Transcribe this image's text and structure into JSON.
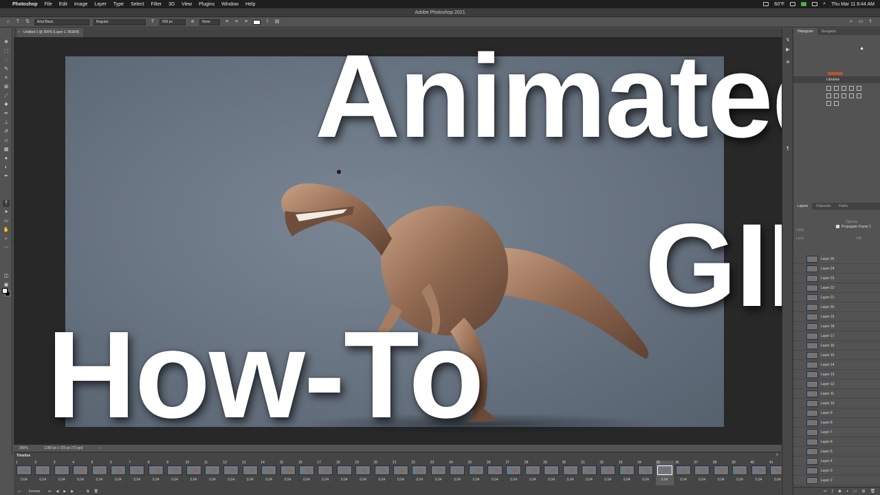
{
  "menubar": {
    "apple": "",
    "app_name": "Photoshop",
    "items": [
      "File",
      "Edit",
      "Image",
      "Layer",
      "Type",
      "Select",
      "Filter",
      "3D",
      "View",
      "Plugins",
      "Window",
      "Help"
    ],
    "weather": "60°F",
    "clock": "Thu Mar 11  8:44 AM"
  },
  "title_bar": {
    "title": "Adobe Photoshop 2021"
  },
  "options_bar": {
    "font_family": "Arial Black",
    "font_style": "Regular",
    "font_size": "559 px",
    "anti_alias": "None",
    "text_color": "#ffffff"
  },
  "document": {
    "tab_title": "Untitled-1 @ 300% (Layer 1, RGB/8)"
  },
  "overlay_text": {
    "line1": "Animated",
    "line2": "GIF",
    "line3": "How-To"
  },
  "status_bar": {
    "zoom": "300%",
    "doc_info": "1280 px x 720 px (72 ppi)",
    "arrow": "›"
  },
  "timeline": {
    "title": "Timeline",
    "loop": "Forever",
    "selected_frame": 35,
    "frames": [
      {
        "n": "1",
        "d": "0.04"
      },
      {
        "n": "2",
        "d": "0.04"
      },
      {
        "n": "3",
        "d": "0.04"
      },
      {
        "n": "4",
        "d": "0.04"
      },
      {
        "n": "5",
        "d": "0.04"
      },
      {
        "n": "6",
        "d": "0.04"
      },
      {
        "n": "7",
        "d": "0.04"
      },
      {
        "n": "8",
        "d": "0.04"
      },
      {
        "n": "9",
        "d": "0.04"
      },
      {
        "n": "10",
        "d": "0.04"
      },
      {
        "n": "11",
        "d": "0.04"
      },
      {
        "n": "12",
        "d": "0.04"
      },
      {
        "n": "13",
        "d": "0.04"
      },
      {
        "n": "14",
        "d": "0.04"
      },
      {
        "n": "15",
        "d": "0.04"
      },
      {
        "n": "16",
        "d": "0.04"
      },
      {
        "n": "17",
        "d": "0.04"
      },
      {
        "n": "18",
        "d": "0.04"
      },
      {
        "n": "19",
        "d": "0.04"
      },
      {
        "n": "20",
        "d": "0.04"
      },
      {
        "n": "21",
        "d": "0.04"
      },
      {
        "n": "22",
        "d": "0.04"
      },
      {
        "n": "23",
        "d": "0.04"
      },
      {
        "n": "24",
        "d": "0.04"
      },
      {
        "n": "25",
        "d": "0.04"
      },
      {
        "n": "26",
        "d": "0.04"
      },
      {
        "n": "27",
        "d": "0.04"
      },
      {
        "n": "28",
        "d": "0.04"
      },
      {
        "n": "29",
        "d": "0.04"
      },
      {
        "n": "30",
        "d": "0.04"
      },
      {
        "n": "31",
        "d": "0.04"
      },
      {
        "n": "32",
        "d": "0.04"
      },
      {
        "n": "33",
        "d": "0.04"
      },
      {
        "n": "34",
        "d": "0.04"
      },
      {
        "n": "35",
        "d": "0.04"
      },
      {
        "n": "36",
        "d": "0.04"
      },
      {
        "n": "37",
        "d": "0.04"
      },
      {
        "n": "38",
        "d": "0.04"
      },
      {
        "n": "39",
        "d": "0.04"
      },
      {
        "n": "40",
        "d": "0.04"
      },
      {
        "n": "41",
        "d": "0.04"
      }
    ]
  },
  "panels": {
    "top_tabs": [
      "Histogram",
      "Navigator"
    ],
    "libraries": "Libraries",
    "layers_tabs": [
      "Layers",
      "Channels",
      "Paths"
    ],
    "propagate": "Propagate Frame 1",
    "unify_label": "Unify:",
    "lock_label": "Lock:",
    "opacity_label": "Opacity:",
    "fill_label": "Fill:",
    "layers": [
      "Layer 25",
      "Layer 24",
      "Layer 23",
      "Layer 22",
      "Layer 21",
      "Layer 20",
      "Layer 19",
      "Layer 18",
      "Layer 17",
      "Layer 16",
      "Layer 15",
      "Layer 14",
      "Layer 13",
      "Layer 12",
      "Layer 11",
      "Layer 10",
      "Layer 9",
      "Layer 8",
      "Layer 7",
      "Layer 6",
      "Layer 5",
      "Layer 4",
      "Layer 3",
      "Layer 2"
    ]
  }
}
